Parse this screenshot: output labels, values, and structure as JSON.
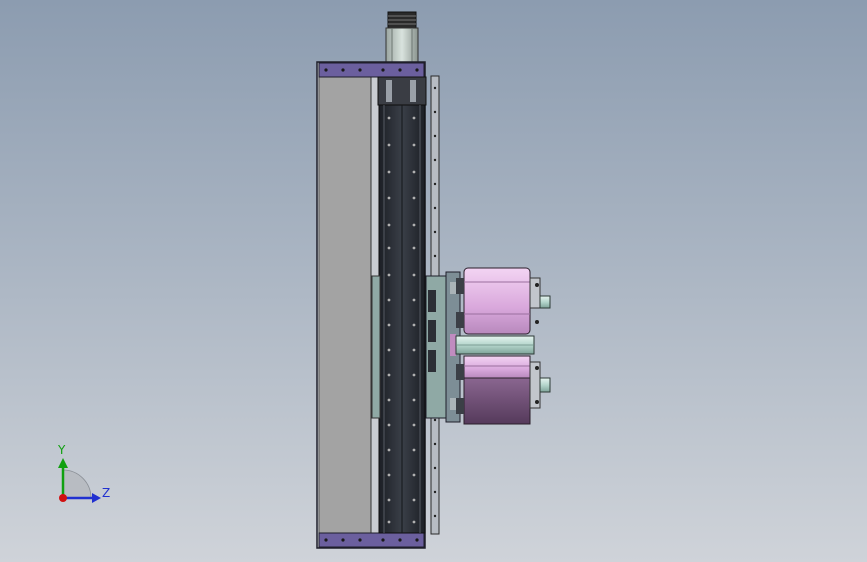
{
  "viewport": {
    "background_top": "#8c9cb0",
    "background_bottom": "#cfd3d9"
  },
  "model": {
    "name": "linear-actuator-assembly",
    "colors": {
      "frame_outline": "#1e1e2a",
      "side_panel": "#a3a3a3",
      "rail": "#2a2e36",
      "end_plate": "#6b5f9e",
      "carriage_plate": "#8fa9a5",
      "motor_pink": "#e4b8e8",
      "motor_dark": "#6a4a6a",
      "shaft": "#b8d8d0"
    }
  },
  "triad": {
    "y_label": "Y",
    "z_label": "Z",
    "colors": {
      "y": "#10a010",
      "z": "#2030d0",
      "origin": "#d01010"
    }
  }
}
